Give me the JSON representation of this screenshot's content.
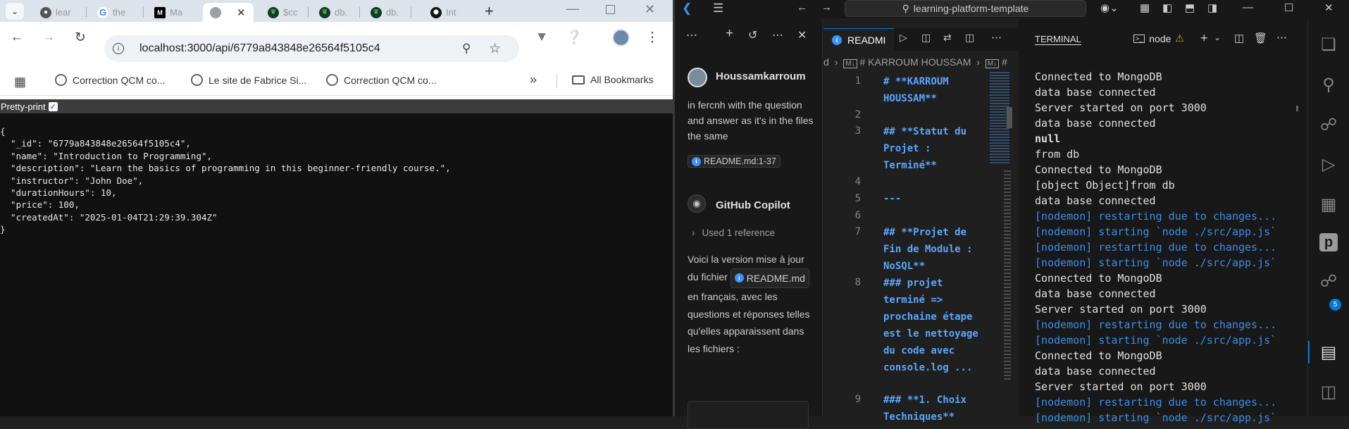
{
  "browser": {
    "tabs": [
      {
        "label": "lear",
        "icon": "github-icon"
      },
      {
        "label": "the",
        "icon": "google-icon"
      },
      {
        "label": "Ma",
        "icon": "medium-icon"
      },
      {
        "label": "",
        "icon": "globe-icon",
        "active": true
      },
      {
        "label": "$cc",
        "icon": "mongodb-icon"
      },
      {
        "label": "db.",
        "icon": "mongodb-icon"
      },
      {
        "label": "db.",
        "icon": "mongodb-icon"
      },
      {
        "label": "Int",
        "icon": "openai-icon"
      }
    ],
    "url": "localhost:3000/api/6779a843848e26564f5105c4",
    "bookmarks": [
      {
        "label": "Correction QCM co..."
      },
      {
        "label": "Le site de Fabrice Si..."
      },
      {
        "label": "Correction QCM co..."
      }
    ],
    "all_bookmarks_label": "All Bookmarks",
    "pretty_print_label": "Pretty-print",
    "json_lines": [
      "{",
      "  \"_id\": \"6779a843848e26564f5105c4\",",
      "  \"name\": \"Introduction to Programming\",",
      "  \"description\": \"Learn the basics of programming in this beginner-friendly course.\",",
      "  \"instructor\": \"John Doe\",",
      "  \"durationHours\": 10,",
      "  \"price\": 100,",
      "  \"createdAt\": \"2025-01-04T21:29:39.304Z\"",
      "}"
    ]
  },
  "vscode": {
    "command_center": "learning-platform-template",
    "chat": {
      "user_name": "Houssamkarroum",
      "user_message": "in fercnh with the question and answer as it's in the files the same",
      "user_ref": "README.md:1-37",
      "assistant_name": "GitHub Copilot",
      "used_refs": "Used 1 reference",
      "reply_before": "Voici la version mise à jour du fichier",
      "reply_ref": "README.md",
      "reply_after_1": "en",
      "reply_after_2": "français, avec les questions et réponses telles qu'elles apparaissent dans les fichiers :"
    },
    "editor": {
      "tab_label": "READMI",
      "breadcrumb_1": "d",
      "breadcrumb_2": "# KARROUM HOUSSAM",
      "breadcrumb_3": "#",
      "lines": [
        {
          "n": "1",
          "text": "# **KARROUM HOUSSAM**"
        },
        {
          "n": "2",
          "text": ""
        },
        {
          "n": "3",
          "text": "## **Statut du Projet : Terminé**"
        },
        {
          "n": "4",
          "text": ""
        },
        {
          "n": "5",
          "text": "---"
        },
        {
          "n": "6",
          "text": ""
        },
        {
          "n": "7",
          "text": "## **Projet de Fin de Module : NoSQL**"
        },
        {
          "n": "8",
          "text": "### projet terminé => prochaine étape est le nettoyage du code avec console.log ..."
        },
        {
          "n": "9",
          "text": "### **1. Choix Techniques**"
        }
      ]
    },
    "terminal": {
      "title": "TERMINAL",
      "shell_label": "node",
      "lines": [
        {
          "text": "Connected to MongoDB",
          "kind": "plain"
        },
        {
          "text": "data base connected",
          "kind": "plain"
        },
        {
          "text": "Server started on port 3000",
          "kind": "plain"
        },
        {
          "text": "data base connected",
          "kind": "plain"
        },
        {
          "text": "null",
          "kind": "bold"
        },
        {
          "text": "from db",
          "kind": "plain"
        },
        {
          "text": "Connected to MongoDB",
          "kind": "plain"
        },
        {
          "text": "[object Object]from db",
          "kind": "plain"
        },
        {
          "text": "data base connected",
          "kind": "plain"
        },
        {
          "text": "[nodemon] restarting due to changes...",
          "kind": "nodemon"
        },
        {
          "text": "[nodemon] starting `node ./src/app.js`",
          "kind": "nodemon"
        },
        {
          "text": "[nodemon] restarting due to changes...",
          "kind": "nodemon"
        },
        {
          "text": "[nodemon] starting `node ./src/app.js`",
          "kind": "nodemon"
        },
        {
          "text": "Connected to MongoDB",
          "kind": "plain"
        },
        {
          "text": "data base connected",
          "kind": "plain"
        },
        {
          "text": "Server started on port 3000",
          "kind": "plain"
        },
        {
          "text": "[nodemon] restarting due to changes...",
          "kind": "nodemon"
        },
        {
          "text": "[nodemon] starting `node ./src/app.js`",
          "kind": "nodemon"
        },
        {
          "text": "Connected to MongoDB",
          "kind": "plain"
        },
        {
          "text": "data base connected",
          "kind": "plain"
        },
        {
          "text": "Server started on port 3000",
          "kind": "plain"
        },
        {
          "text": "[nodemon] restarting due to changes...",
          "kind": "nodemon"
        },
        {
          "text": "[nodemon] starting `node ./src/app.js`",
          "kind": "nodemon"
        }
      ]
    },
    "source_control_badge": "5",
    "colors": {
      "accent": "#0078d4",
      "nodemon": "#3b8eea",
      "warning": "#cca700"
    }
  }
}
